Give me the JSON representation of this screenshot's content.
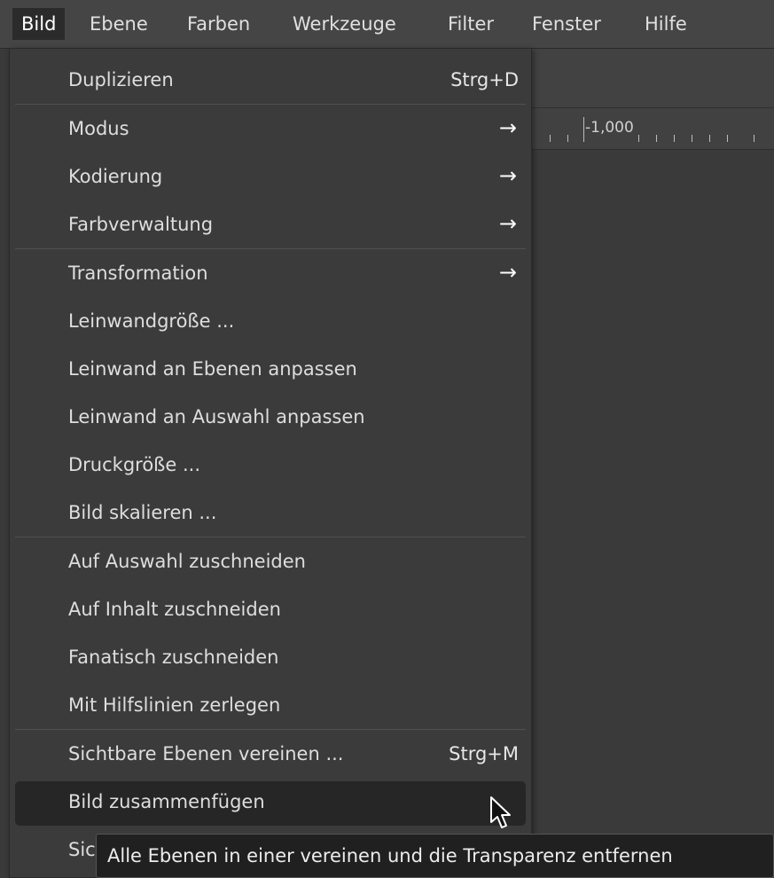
{
  "menubar": {
    "items": [
      {
        "label": "Bild",
        "active": true
      },
      {
        "label": "Ebene"
      },
      {
        "label": "Farben"
      },
      {
        "label": "Werkzeuge"
      },
      {
        "label": "Filter"
      },
      {
        "label": "Fenster"
      },
      {
        "label": "Hilfe"
      }
    ]
  },
  "ruler": {
    "label": "-1,000"
  },
  "menu": {
    "items": [
      {
        "label": "Duplizieren",
        "shortcut": "Strg+D"
      },
      {
        "label": "Modus",
        "submenu": "→"
      },
      {
        "label": "Kodierung",
        "submenu": "→"
      },
      {
        "label": "Farbverwaltung",
        "submenu": "→"
      },
      {
        "label": "Transformation",
        "submenu": "→"
      },
      {
        "label": "Leinwandgröße ..."
      },
      {
        "label": "Leinwand an Ebenen anpassen"
      },
      {
        "label": "Leinwand an Auswahl anpassen"
      },
      {
        "label": "Druckgröße ..."
      },
      {
        "label": "Bild skalieren ..."
      },
      {
        "label": "Auf Auswahl zuschneiden"
      },
      {
        "label": "Auf Inhalt zuschneiden"
      },
      {
        "label": "Fanatisch zuschneiden"
      },
      {
        "label": "Mit Hilfslinien zerlegen"
      },
      {
        "label": "Sichtbare Ebenen vereinen ...",
        "shortcut": "Strg+M"
      },
      {
        "label": "Bild zusammenfügen",
        "hovered": true
      },
      {
        "label": "Sic"
      }
    ]
  },
  "tooltip": {
    "text": "Alle Ebenen in einer vereinen und die Transparenz entfernen"
  },
  "cursor": {
    "icon": "mouse-pointer-icon"
  },
  "colors": {
    "menu_bg": "#3b3b3b",
    "hover_bg": "#262626",
    "menubar_bg": "#454545"
  }
}
